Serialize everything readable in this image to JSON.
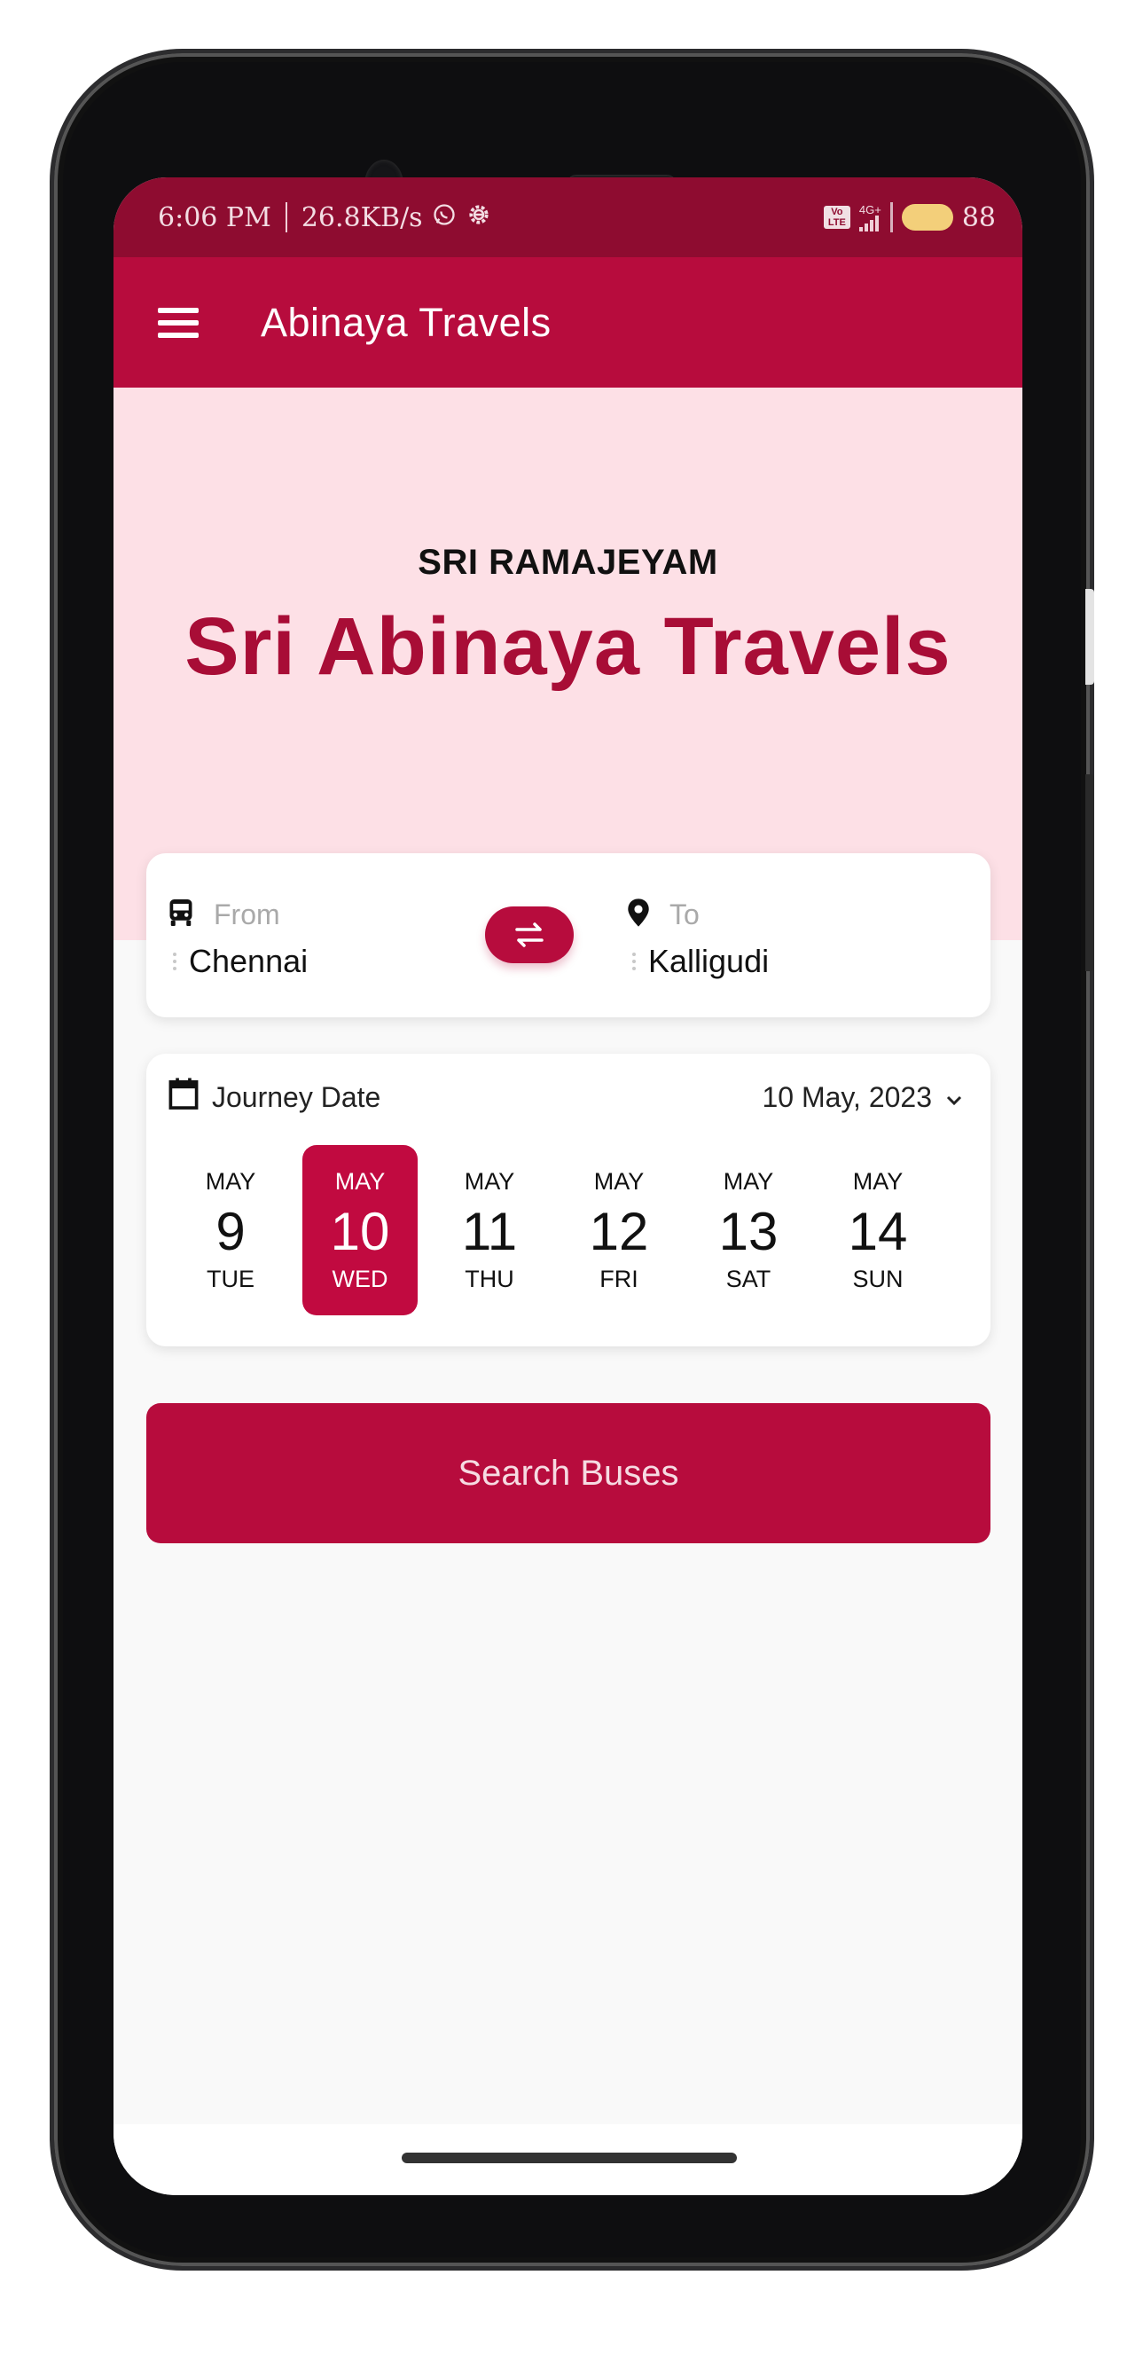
{
  "status_bar": {
    "time": "6:06 PM",
    "network_speed": "26.8KB/s",
    "notification_icons": [
      "whatsapp-icon",
      "settings-gear-icon"
    ],
    "volte_label": "Vo LTE",
    "network_type": "4G+",
    "battery_percent": "88"
  },
  "app_bar": {
    "title": "Abinaya Travels",
    "menu_icon": "hamburger-menu-icon"
  },
  "hero": {
    "subtitle": "SRI RAMAJEYAM",
    "title": "Sri Abinaya Travels"
  },
  "route": {
    "from_label": "From",
    "from_value": "Chennai",
    "from_icon": "bus-icon",
    "to_label": "To",
    "to_value": "Kalligudi",
    "to_icon": "location-pin-icon",
    "swap_icon": "swap-arrows-icon"
  },
  "journey_date": {
    "label": "Journey Date",
    "selected_date": "10 May, 2023",
    "icon": "calendar-icon",
    "days": [
      {
        "month": "MAY",
        "date": "9",
        "weekday": "TUE",
        "selected": false
      },
      {
        "month": "MAY",
        "date": "10",
        "weekday": "WED",
        "selected": true
      },
      {
        "month": "MAY",
        "date": "11",
        "weekday": "THU",
        "selected": false
      },
      {
        "month": "MAY",
        "date": "12",
        "weekday": "FRI",
        "selected": false
      },
      {
        "month": "MAY",
        "date": "13",
        "weekday": "SAT",
        "selected": false
      },
      {
        "month": "MAY",
        "date": "14",
        "weekday": "SUN",
        "selected": false
      }
    ]
  },
  "search_button": {
    "label": "Search Buses"
  },
  "colors": {
    "primary": "#b70c3d",
    "status_bar": "#8e0c30",
    "hero_background": "#fde0e6",
    "hero_title": "#a80d36",
    "page_background": "#f9f9f9"
  }
}
